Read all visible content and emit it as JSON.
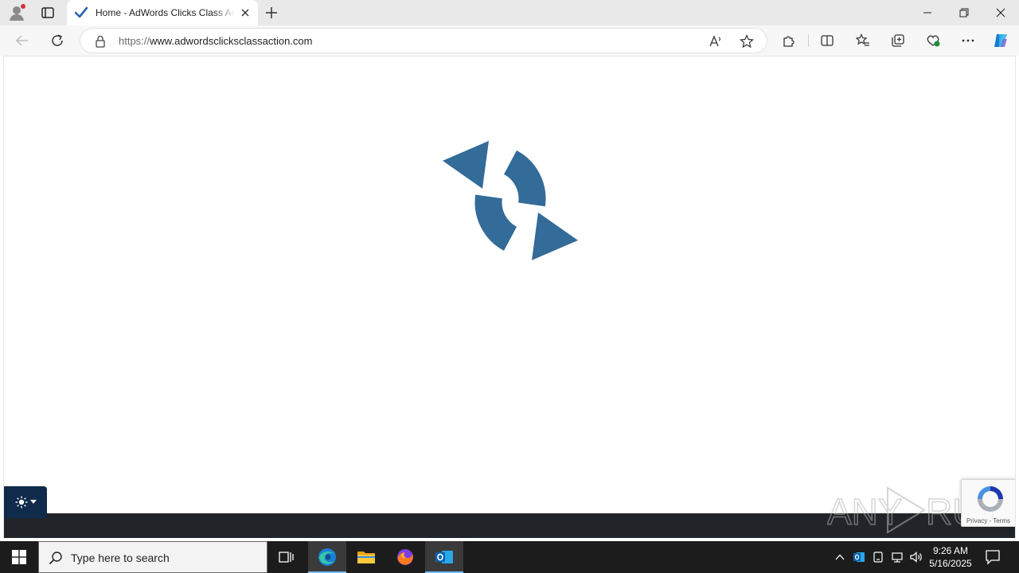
{
  "browser": {
    "tab": {
      "title": "Home - AdWords Clicks Class Action"
    },
    "address": {
      "url_prefix": "https://",
      "url_host": "www.adwordsclicksclassaction.com"
    }
  },
  "page": {
    "spinner_color": "#336b99",
    "recaptcha": {
      "privacy": "Privacy",
      "separator": " - ",
      "terms": "Terms"
    },
    "watermark": {
      "text_left": "ANY",
      "text_right": "RUN"
    }
  },
  "taskbar": {
    "search_placeholder": "Type here to search",
    "clock": {
      "time": "9:26 AM",
      "date": "5/16/2025"
    }
  }
}
